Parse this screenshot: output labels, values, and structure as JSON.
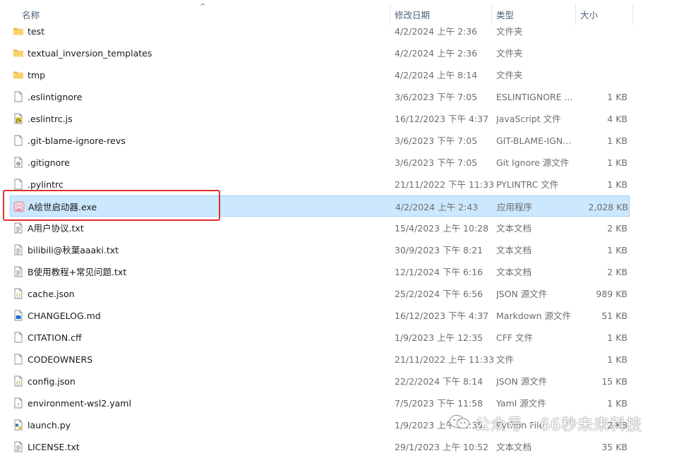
{
  "columns": {
    "name": "名称",
    "date": "修改日期",
    "type": "类型",
    "size": "大小"
  },
  "sort_indicator": "^",
  "files": [
    {
      "name": "test",
      "date": "4/2/2024 上午 2:36",
      "type": "文件夹",
      "size": "",
      "icon": "folder-icon"
    },
    {
      "name": "textual_inversion_templates",
      "date": "4/2/2024 上午 2:36",
      "type": "文件夹",
      "size": "",
      "icon": "folder-icon"
    },
    {
      "name": "tmp",
      "date": "4/2/2024 上午 8:14",
      "type": "文件夹",
      "size": "",
      "icon": "folder-icon"
    },
    {
      "name": ".eslintignore",
      "date": "3/6/2023 下午 7:05",
      "type": "ESLINTIGNORE ...",
      "size": "1 KB",
      "icon": "file-icon"
    },
    {
      "name": ".eslintrc.js",
      "date": "16/12/2023 下午 4:37",
      "type": "JavaScript 文件",
      "size": "4 KB",
      "icon": "js-file-icon"
    },
    {
      "name": ".git-blame-ignore-revs",
      "date": "3/6/2023 下午 7:05",
      "type": "GIT-BLAME-IGN...",
      "size": "1 KB",
      "icon": "file-icon"
    },
    {
      "name": ".gitignore",
      "date": "3/6/2023 下午 7:05",
      "type": "Git Ignore 源文件",
      "size": "1 KB",
      "icon": "gear-file-icon"
    },
    {
      "name": ".pylintrc",
      "date": "21/11/2022 下午 11:33",
      "type": "PYLINTRC 文件",
      "size": "1 KB",
      "icon": "file-icon"
    },
    {
      "name": "A绘世启动器.exe",
      "date": "4/2/2024 上午 2:43",
      "type": "应用程序",
      "size": "2,028 KB",
      "icon": "exe-app-icon",
      "selected": true
    },
    {
      "name": "A用户协议.txt",
      "date": "15/4/2023 上午 10:28",
      "type": "文本文档",
      "size": "2 KB",
      "icon": "text-file-icon"
    },
    {
      "name": "bilibili@秋葉aaaki.txt",
      "date": "30/9/2023 下午 8:21",
      "type": "文本文档",
      "size": "1 KB",
      "icon": "text-file-icon"
    },
    {
      "name": "B使用教程+常见问题.txt",
      "date": "12/1/2024 下午 6:16",
      "type": "文本文档",
      "size": "2 KB",
      "icon": "text-file-icon"
    },
    {
      "name": "cache.json",
      "date": "25/2/2024 下午 6:56",
      "type": "JSON 源文件",
      "size": "989 KB",
      "icon": "json-file-icon"
    },
    {
      "name": "CHANGELOG.md",
      "date": "16/12/2023 下午 4:37",
      "type": "Markdown 源文件",
      "size": "51 KB",
      "icon": "markdown-file-icon"
    },
    {
      "name": "CITATION.cff",
      "date": "1/9/2023 上午 12:35",
      "type": "CFF 文件",
      "size": "1 KB",
      "icon": "file-icon"
    },
    {
      "name": "CODEOWNERS",
      "date": "21/11/2022 上午 11:33",
      "type": "文件",
      "size": "1 KB",
      "icon": "file-icon"
    },
    {
      "name": "config.json",
      "date": "22/2/2024 下午 8:14",
      "type": "JSON 源文件",
      "size": "15 KB",
      "icon": "json-file-icon"
    },
    {
      "name": "environment-wsl2.yaml",
      "date": "7/5/2023 下午 11:58",
      "type": "Yaml 源文件",
      "size": "1 KB",
      "icon": "yaml-file-icon"
    },
    {
      "name": "launch.py",
      "date": "1/9/2023 上午 12:35",
      "type": "Python File",
      "size": "2 KB",
      "icon": "python-file-icon"
    },
    {
      "name": "LICENSE.txt",
      "date": "29/1/2023 上午 10:52",
      "type": "文本文档",
      "size": "35 KB",
      "icon": "text-file-icon"
    }
  ],
  "watermark": {
    "text": "公众号 · 66秒未来科技"
  },
  "colors": {
    "selection_bg": "#cce8ff",
    "selection_border": "#99d1ff",
    "highlight_box": "#e0302a",
    "folder": "#f3c145"
  }
}
